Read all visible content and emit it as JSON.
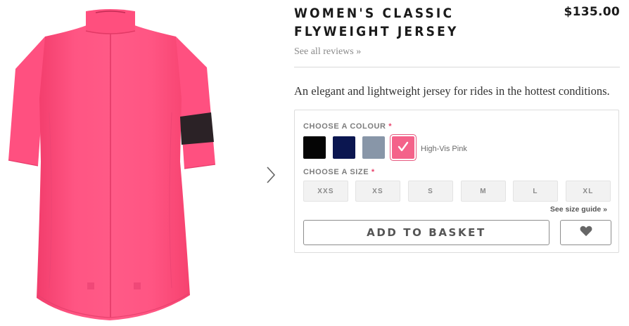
{
  "product": {
    "title_line1": "WOMEN'S CLASSIC",
    "title_line2": "FLYWEIGHT JERSEY",
    "price": "$135.00",
    "reviews_link": "See all reviews »",
    "description": "An elegant and lightweight jersey for rides in the hottest conditions."
  },
  "gallery": {
    "image_icon": "jersey-image",
    "next_icon": "chevron-right-icon",
    "colors": {
      "jersey": "#ff4f7e",
      "armband": "#2b2226"
    }
  },
  "options": {
    "colour_label": "CHOOSE A COLOUR",
    "required_mark": "*",
    "selected_colour_name": "High-Vis Pink",
    "swatches": [
      {
        "name": "Black",
        "color": "#050505",
        "selected": false
      },
      {
        "name": "Navy",
        "color": "#0b1650",
        "selected": false
      },
      {
        "name": "Grey",
        "color": "#8896a8",
        "selected": false
      },
      {
        "name": "High-Vis Pink",
        "color": "#f4628a",
        "selected": true
      }
    ],
    "size_label": "CHOOSE A SIZE",
    "sizes": [
      "XXS",
      "XS",
      "S",
      "M",
      "L",
      "XL"
    ],
    "size_guide": "See size guide »",
    "add_to_basket": "ADD TO BASKET",
    "wishlist_icon": "heart-icon"
  },
  "theme": {
    "accent": "#e8436b"
  }
}
